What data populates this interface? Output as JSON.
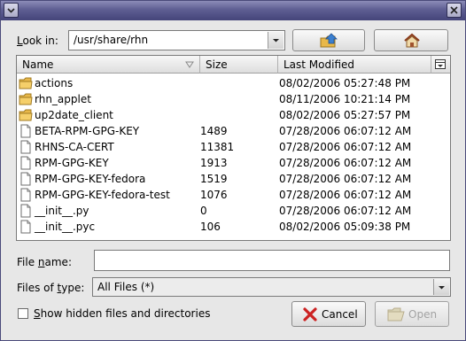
{
  "dialog": {
    "look_in_label": "Look in:",
    "look_in_path": "/usr/share/rhn",
    "file_name_label": "File name:",
    "file_name_value": "",
    "files_of_type_label": "Files of type:",
    "files_of_type_value": "All Files (*)",
    "show_hidden_label": "Show hidden files and directories",
    "show_hidden_checked": false,
    "cancel_label": "Cancel",
    "open_label": "Open"
  },
  "columns": {
    "name": "Name",
    "size": "Size",
    "modified": "Last Modified"
  },
  "files": [
    {
      "name": "actions",
      "size": "",
      "modified": "08/02/2006 05:27:48 PM",
      "type": "folder"
    },
    {
      "name": "rhn_applet",
      "size": "",
      "modified": "08/11/2006 10:21:14 PM",
      "type": "folder"
    },
    {
      "name": "up2date_client",
      "size": "",
      "modified": "08/02/2006 05:27:57 PM",
      "type": "folder"
    },
    {
      "name": "BETA-RPM-GPG-KEY",
      "size": "1489",
      "modified": "07/28/2006 06:07:12 AM",
      "type": "file"
    },
    {
      "name": "RHNS-CA-CERT",
      "size": "11381",
      "modified": "07/28/2006 06:07:12 AM",
      "type": "file"
    },
    {
      "name": "RPM-GPG-KEY",
      "size": "1913",
      "modified": "07/28/2006 06:07:12 AM",
      "type": "file"
    },
    {
      "name": "RPM-GPG-KEY-fedora",
      "size": "1519",
      "modified": "07/28/2006 06:07:12 AM",
      "type": "file"
    },
    {
      "name": "RPM-GPG-KEY-fedora-test",
      "size": "1076",
      "modified": "07/28/2006 06:07:12 AM",
      "type": "file"
    },
    {
      "name": "__init__.py",
      "size": "0",
      "modified": "07/28/2006 06:07:12 AM",
      "type": "file"
    },
    {
      "name": "__init__.pyc",
      "size": "106",
      "modified": "08/02/2006 05:09:38 PM",
      "type": "file"
    }
  ],
  "icons": {
    "window_menu": "chevron-down-icon",
    "close": "close-icon",
    "up": "folder-up-icon",
    "home": "home-icon",
    "folder": "folder-icon",
    "file": "file-icon",
    "cancel": "cancel-x-icon",
    "open": "open-folder-icon"
  },
  "colors": {
    "titlebar": "#5e5e92",
    "folder": "#e8b84a",
    "cancel_x": "#cc2222"
  }
}
